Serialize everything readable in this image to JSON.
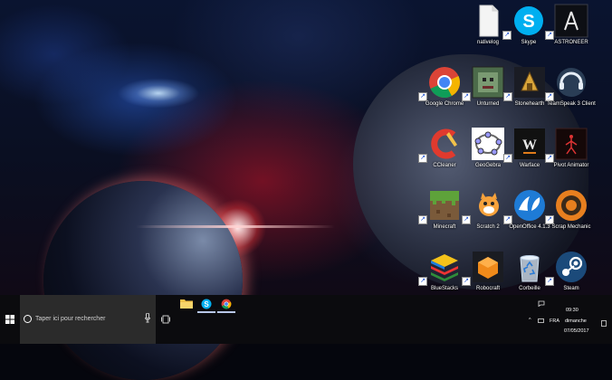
{
  "desktop": {
    "icons": [
      {
        "label": "nativelog",
        "icon": "file-icon"
      },
      {
        "label": "Skype",
        "icon": "skype-icon"
      },
      {
        "label": "ASTRONEER",
        "icon": "astroneer-icon"
      },
      {
        "label": "Google Chrome",
        "icon": "chrome-icon"
      },
      {
        "label": "Unturned",
        "icon": "unturned-icon"
      },
      {
        "label": "Stonehearth",
        "icon": "stonehearth-icon"
      },
      {
        "label": "TeamSpeak 3 Client",
        "icon": "teamspeak-icon"
      },
      {
        "label": "CCleaner",
        "icon": "ccleaner-icon"
      },
      {
        "label": "GeoGebra",
        "icon": "geogebra-icon"
      },
      {
        "label": "Warface",
        "icon": "warface-icon"
      },
      {
        "label": "Pivot Animator",
        "icon": "pivot-animator-icon"
      },
      {
        "label": "Minecraft",
        "icon": "minecraft-icon"
      },
      {
        "label": "Scratch 2",
        "icon": "scratch-icon"
      },
      {
        "label": "OpenOffice 4.1.3",
        "icon": "openoffice-icon"
      },
      {
        "label": "Scrap Mechanic",
        "icon": "scrap-mechanic-icon"
      },
      {
        "label": "BlueStacks",
        "icon": "bluestacks-icon"
      },
      {
        "label": "Robocraft",
        "icon": "robocraft-icon"
      },
      {
        "label": "Corbeille",
        "icon": "recycle-bin-icon"
      },
      {
        "label": "Steam",
        "icon": "steam-icon"
      }
    ]
  },
  "taskbar": {
    "search_placeholder": "Taper ici pour rechercher",
    "pinned": [
      "file-explorer-icon",
      "skype-icon",
      "chrome-icon"
    ],
    "tray": {
      "language": "FRA",
      "time": "09:30",
      "day": "dimanche",
      "date": "07/05/2017"
    }
  },
  "colors": {
    "taskbar_bg": "#0b0b0e",
    "search_bg": "#2b2b2b",
    "active_underline": "#b8c7e8"
  }
}
